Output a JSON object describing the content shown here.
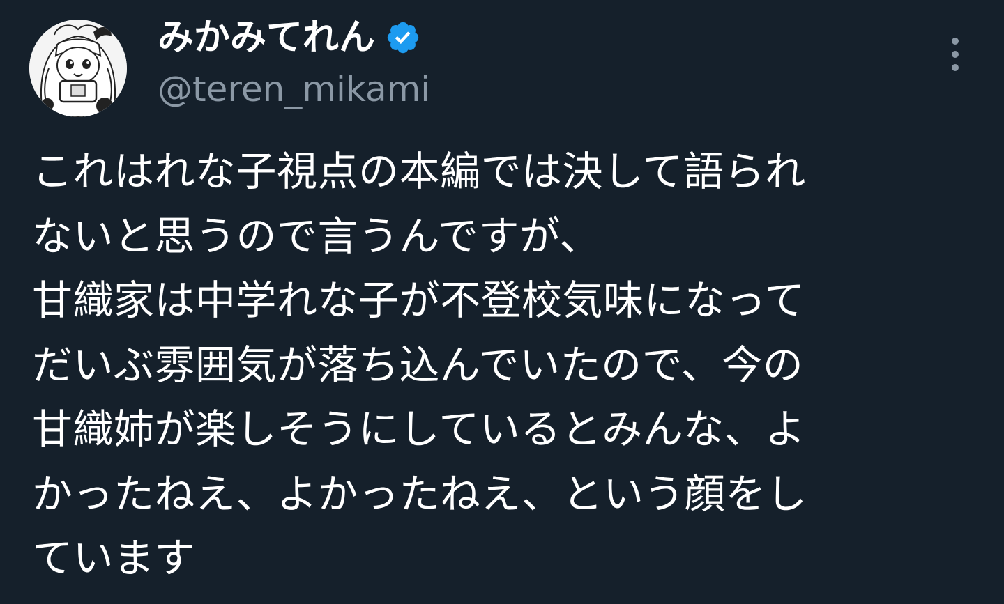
{
  "colors": {
    "background": "#15202b",
    "text_primary": "#ffffff",
    "text_secondary": "#8b98a5",
    "verified_badge": "#1d9bf0"
  },
  "user": {
    "display_name": "みかみてれん",
    "handle": "@teren_mikami",
    "verified": true,
    "avatar_icon": "anime-girl-avatar-icon",
    "verified_icon": "verified-badge-icon"
  },
  "menu": {
    "icon": "more-vertical-icon"
  },
  "tweet": {
    "lines": [
      "これはれな子視点の本編では決して語られ",
      "ないと思うので言うんですが、",
      "甘織家は中学れな子が不登校気味になって",
      "だいぶ雰囲気が落ち込んでいたので、今の",
      "甘織姉が楽しそうにしているとみんな、よ",
      "かったねえ、よかったねえ、という顔をし",
      "ています"
    ]
  }
}
